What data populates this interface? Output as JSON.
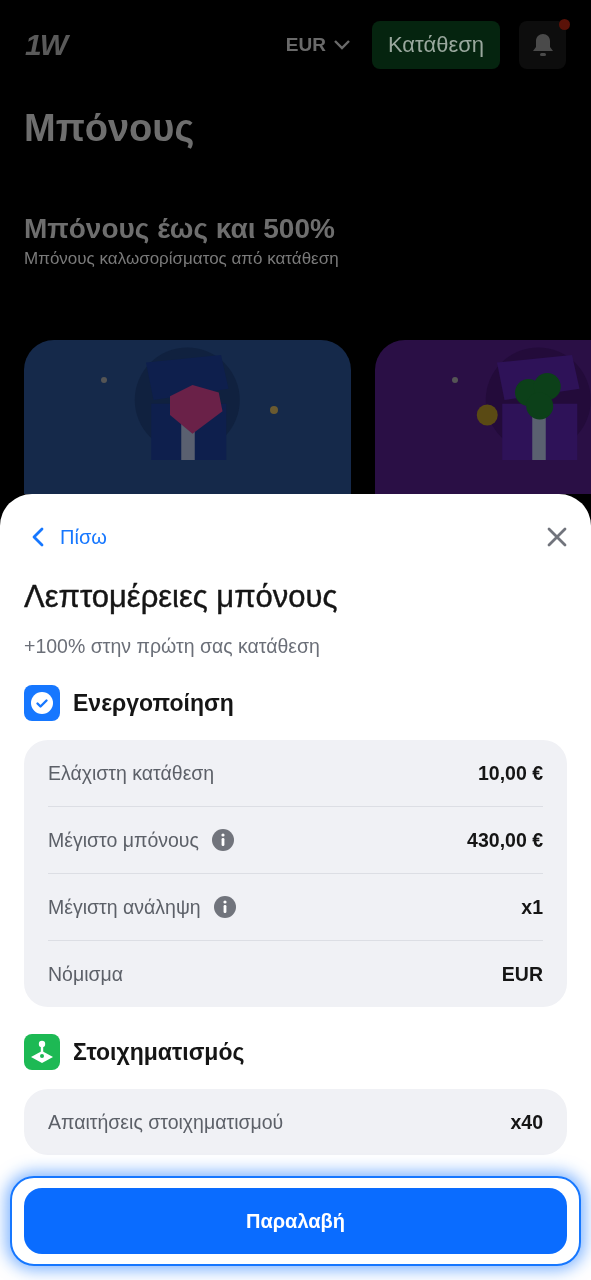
{
  "header": {
    "logo": "1W",
    "currency": "EUR",
    "deposit_button": "Κατάθεση",
    "notification_dot": true
  },
  "page": {
    "title": "Μπόνους",
    "promo_title": "Μπόνους έως και 500%",
    "promo_subtitle": "Μπόνους καλωσορίσματος από κατάθεση",
    "cards": [
      {
        "kind": "diamond"
      },
      {
        "kind": "clover"
      }
    ]
  },
  "sheet": {
    "back": "Πίσω",
    "title": "Λεπτομέρειες μπόνους",
    "subtitle": "+100% στην πρώτη σας κατάθεση",
    "sections": [
      {
        "kind": "activation",
        "title": "Ενεργοποίηση",
        "rows": [
          {
            "label": "Ελάχιστη κατάθεση",
            "value": "10,00 €",
            "info": false
          },
          {
            "label": "Μέγιστο μπόνους",
            "value": "430,00 €",
            "info": true
          },
          {
            "label": "Μέγιστη ανάληψη",
            "value": "x1",
            "info": true
          },
          {
            "label": "Νόμισμα",
            "value": "EUR",
            "info": false
          }
        ]
      },
      {
        "kind": "betting",
        "title": "Στοιχηματισμός",
        "rows": [
          {
            "label": "Απαιτήσεις στοιχηματισμού",
            "value": "x40",
            "info": false
          }
        ]
      }
    ],
    "claim_button": "Παραλαβή"
  }
}
